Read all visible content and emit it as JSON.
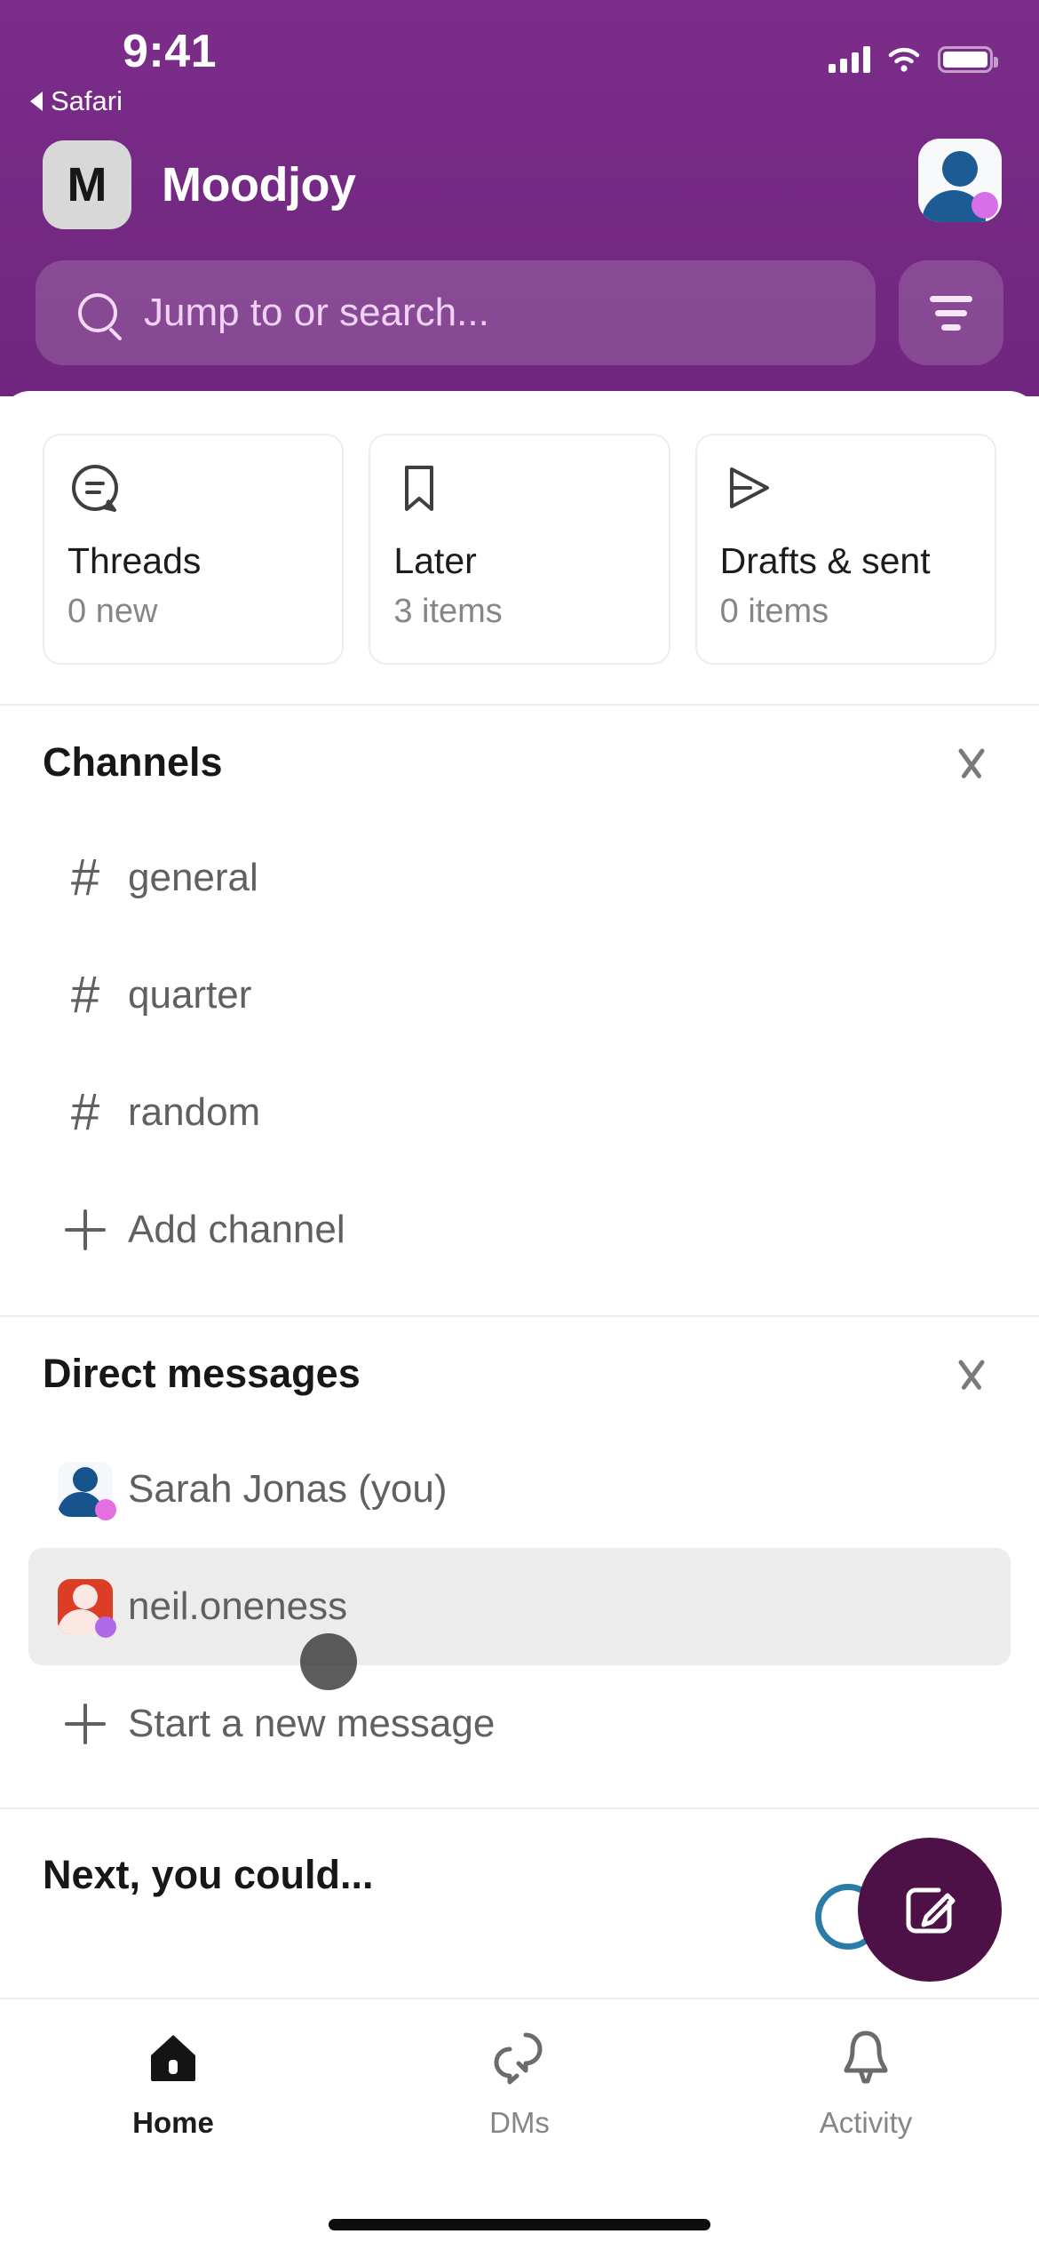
{
  "status_bar": {
    "time": "9:41",
    "back_label": "Safari",
    "icons": [
      "signal-bars-icon",
      "wifi-icon",
      "battery-icon"
    ]
  },
  "header": {
    "workspace_initial": "M",
    "workspace_name": "Moodjoy",
    "avatar_name": "user-avatar",
    "background_color": "#76298a"
  },
  "search": {
    "placeholder": "Jump to or search...",
    "icon": "search-icon",
    "filter_icon": "filter-icon"
  },
  "cards": [
    {
      "icon": "threads-icon",
      "title": "Threads",
      "subtitle": "0 new"
    },
    {
      "icon": "bookmark-icon",
      "title": "Later",
      "subtitle": "3 items"
    },
    {
      "icon": "send-icon",
      "title": "Drafts & sent",
      "subtitle": "0 items"
    }
  ],
  "channels": {
    "title": "Channels",
    "collapse_icon": "chevron-down-icon",
    "items": [
      {
        "icon": "hash-icon",
        "label": "general"
      },
      {
        "icon": "hash-icon",
        "label": "quarter"
      },
      {
        "icon": "hash-icon",
        "label": "random"
      },
      {
        "icon": "plus-icon",
        "label": "Add channel"
      }
    ]
  },
  "direct_messages": {
    "title": "Direct messages",
    "collapse_icon": "chevron-down-icon",
    "items": [
      {
        "icon": "avatar-sarah",
        "label": "Sarah Jonas (you)",
        "selected": false
      },
      {
        "icon": "avatar-neil",
        "label": "neil.oneness",
        "selected": true
      },
      {
        "icon": "plus-icon",
        "label": "Start a new message",
        "selected": false
      }
    ]
  },
  "next_section": {
    "title": "Next, you could..."
  },
  "fab": {
    "label": "compose-button",
    "icon": "compose-icon",
    "color": "#4d1047"
  },
  "tabbar": {
    "items": [
      {
        "icon": "home-icon",
        "label": "Home",
        "active": true
      },
      {
        "icon": "dms-icon",
        "label": "DMs",
        "active": false
      },
      {
        "icon": "bell-icon",
        "label": "Activity",
        "active": false
      }
    ]
  }
}
